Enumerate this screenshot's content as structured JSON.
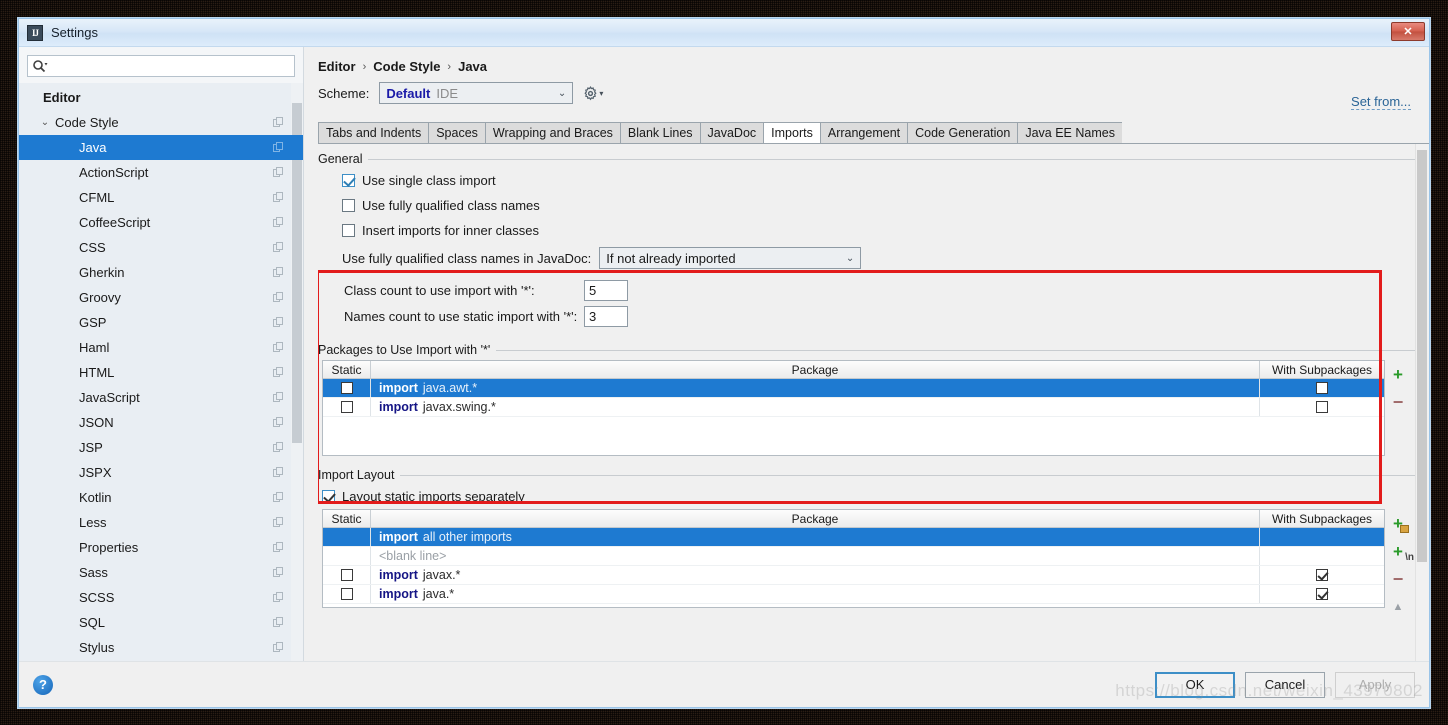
{
  "window": {
    "title": "Settings",
    "app_icon": "IJ",
    "close_label": "✕"
  },
  "sidebar": {
    "search": {
      "placeholder": "",
      "value": "",
      "icon": "search-icon"
    },
    "items": [
      {
        "label": "Editor",
        "level": "root",
        "chevron": "",
        "copy": false,
        "selected": false
      },
      {
        "label": "Code Style",
        "level": "lvl1",
        "chevron": "⌄",
        "copy": true,
        "selected": false
      },
      {
        "label": "Java",
        "level": "lvl2",
        "chevron": "",
        "copy": true,
        "selected": true
      },
      {
        "label": "ActionScript",
        "level": "lvl2",
        "chevron": "",
        "copy": true,
        "selected": false
      },
      {
        "label": "CFML",
        "level": "lvl2",
        "chevron": "",
        "copy": true,
        "selected": false
      },
      {
        "label": "CoffeeScript",
        "level": "lvl2",
        "chevron": "",
        "copy": true,
        "selected": false
      },
      {
        "label": "CSS",
        "level": "lvl2",
        "chevron": "",
        "copy": true,
        "selected": false
      },
      {
        "label": "Gherkin",
        "level": "lvl2",
        "chevron": "",
        "copy": true,
        "selected": false
      },
      {
        "label": "Groovy",
        "level": "lvl2",
        "chevron": "",
        "copy": true,
        "selected": false
      },
      {
        "label": "GSP",
        "level": "lvl2",
        "chevron": "",
        "copy": true,
        "selected": false
      },
      {
        "label": "Haml",
        "level": "lvl2",
        "chevron": "",
        "copy": true,
        "selected": false
      },
      {
        "label": "HTML",
        "level": "lvl2",
        "chevron": "",
        "copy": true,
        "selected": false
      },
      {
        "label": "JavaScript",
        "level": "lvl2",
        "chevron": "",
        "copy": true,
        "selected": false
      },
      {
        "label": "JSON",
        "level": "lvl2",
        "chevron": "",
        "copy": true,
        "selected": false
      },
      {
        "label": "JSP",
        "level": "lvl2",
        "chevron": "",
        "copy": true,
        "selected": false
      },
      {
        "label": "JSPX",
        "level": "lvl2",
        "chevron": "",
        "copy": true,
        "selected": false
      },
      {
        "label": "Kotlin",
        "level": "lvl2",
        "chevron": "",
        "copy": true,
        "selected": false
      },
      {
        "label": "Less",
        "level": "lvl2",
        "chevron": "",
        "copy": true,
        "selected": false
      },
      {
        "label": "Properties",
        "level": "lvl2",
        "chevron": "",
        "copy": true,
        "selected": false
      },
      {
        "label": "Sass",
        "level": "lvl2",
        "chevron": "",
        "copy": true,
        "selected": false
      },
      {
        "label": "SCSS",
        "level": "lvl2",
        "chevron": "",
        "copy": true,
        "selected": false
      },
      {
        "label": "SQL",
        "level": "lvl2",
        "chevron": "",
        "copy": true,
        "selected": false
      },
      {
        "label": "Stylus",
        "level": "lvl2",
        "chevron": "",
        "copy": true,
        "selected": false
      }
    ]
  },
  "header": {
    "breadcrumb": [
      "Editor",
      "Code Style",
      "Java"
    ],
    "separator": "›",
    "scheme_label": "Scheme:",
    "scheme_value_bold": "Default",
    "scheme_value_dim": "IDE",
    "scheme_arrow": "⌄",
    "gear_icon": "gear-icon",
    "gear_caret": "▾",
    "set_from_label": "Set from..."
  },
  "tabs": [
    {
      "label": "Tabs and Indents",
      "active": false
    },
    {
      "label": "Spaces",
      "active": false
    },
    {
      "label": "Wrapping and Braces",
      "active": false
    },
    {
      "label": "Blank Lines",
      "active": false
    },
    {
      "label": "JavaDoc",
      "active": false
    },
    {
      "label": "Imports",
      "active": true
    },
    {
      "label": "Arrangement",
      "active": false
    },
    {
      "label": "Code Generation",
      "active": false
    },
    {
      "label": "Java EE Names",
      "active": false
    }
  ],
  "general": {
    "title": "General",
    "checkboxes": [
      {
        "label": "Use single class import",
        "checked": true
      },
      {
        "label": "Use fully qualified class names",
        "checked": false
      },
      {
        "label": "Insert imports for inner classes",
        "checked": false
      }
    ],
    "javadoc_label": "Use fully qualified class names in JavaDoc:",
    "javadoc_value": "If not already imported",
    "javadoc_arrow": "⌄"
  },
  "counts": [
    {
      "label": "Class count to use import with '*':",
      "value": "5"
    },
    {
      "label": "Names count to use static import with '*':",
      "value": "3"
    }
  ],
  "packages_section": {
    "title": "Packages to Use Import with '*'",
    "columns": {
      "static": "Static",
      "package": "Package",
      "subpackages": "With Subpackages"
    },
    "rows": [
      {
        "static_checked": false,
        "keyword": "import",
        "package": "java.awt.*",
        "sub_checked": false,
        "selected": true,
        "has_static_cb": true,
        "has_sub_cb": true
      },
      {
        "static_checked": false,
        "keyword": "import",
        "package": "javax.swing.*",
        "sub_checked": false,
        "selected": false,
        "has_static_cb": true,
        "has_sub_cb": true
      }
    ],
    "buttons": [
      {
        "name": "add-package-button",
        "glyph": "+"
      },
      {
        "name": "remove-package-button",
        "glyph": "−"
      }
    ]
  },
  "import_layout_section": {
    "title": "Import Layout",
    "layout_static_label": "Layout static imports separately",
    "layout_static_checked": true,
    "columns": {
      "static": "Static",
      "package": "Package",
      "subpackages": "With Subpackages"
    },
    "rows": [
      {
        "keyword": "import",
        "package": "all other imports",
        "static_checked": false,
        "sub_checked": false,
        "selected": true,
        "has_static_cb": false,
        "has_sub_cb": false,
        "blank": false
      },
      {
        "keyword": "",
        "package": "<blank line>",
        "static_checked": false,
        "sub_checked": false,
        "selected": false,
        "has_static_cb": false,
        "has_sub_cb": false,
        "blank": true
      },
      {
        "keyword": "import",
        "package": "javax.*",
        "static_checked": false,
        "sub_checked": true,
        "selected": false,
        "has_static_cb": true,
        "has_sub_cb": true,
        "blank": false
      },
      {
        "keyword": "import",
        "package": "java.*",
        "static_checked": false,
        "sub_checked": true,
        "selected": false,
        "has_static_cb": true,
        "has_sub_cb": true,
        "blank": false
      }
    ],
    "buttons": [
      {
        "name": "add-package-entry-button",
        "glyph": "+"
      },
      {
        "name": "add-blank-line-button",
        "glyph": "+",
        "sub": "\\n"
      },
      {
        "name": "remove-entry-button",
        "glyph": "−"
      },
      {
        "name": "move-up-button",
        "glyph": "▲"
      }
    ]
  },
  "footer": {
    "help_label": "?",
    "ok_label": "OK",
    "cancel_label": "Cancel",
    "apply_label": "Apply",
    "watermark": "https://blog.csdn.net/weixin_43970802"
  },
  "colors": {
    "selection_blue": "#1e7ad1",
    "highlight_red": "#e21b1b",
    "link_blue": "#2a6496",
    "keyword_blue": "#151585",
    "accent_green": "#2a9b2a"
  }
}
